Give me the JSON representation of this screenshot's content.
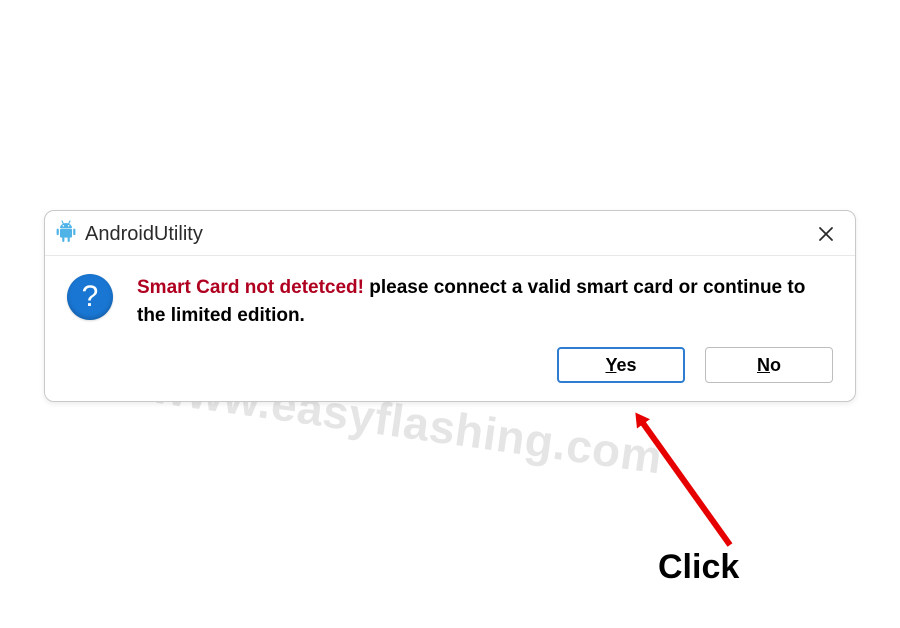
{
  "dialog": {
    "title": "AndroidUtility",
    "icon_name": "android-icon",
    "close_icon_name": "close-icon",
    "help_icon_symbol": "?",
    "message": {
      "alert_prefix": "Smart Card not detetced!",
      "rest": " please connect a valid smart card or continue to the limited edition."
    },
    "buttons": {
      "yes": {
        "mnemonic": "Y",
        "rest": "es"
      },
      "no": {
        "mnemonic": "N",
        "rest": "o"
      }
    }
  },
  "annotation": {
    "label": "Click",
    "arrow_name": "red-arrow"
  },
  "watermark": {
    "text": "www.easyflashing.com"
  },
  "colors": {
    "alert_text": "#b00020",
    "primary_border": "#2f7dd1",
    "help_icon_bg": "#1976d2",
    "annotation": "#e60000"
  }
}
